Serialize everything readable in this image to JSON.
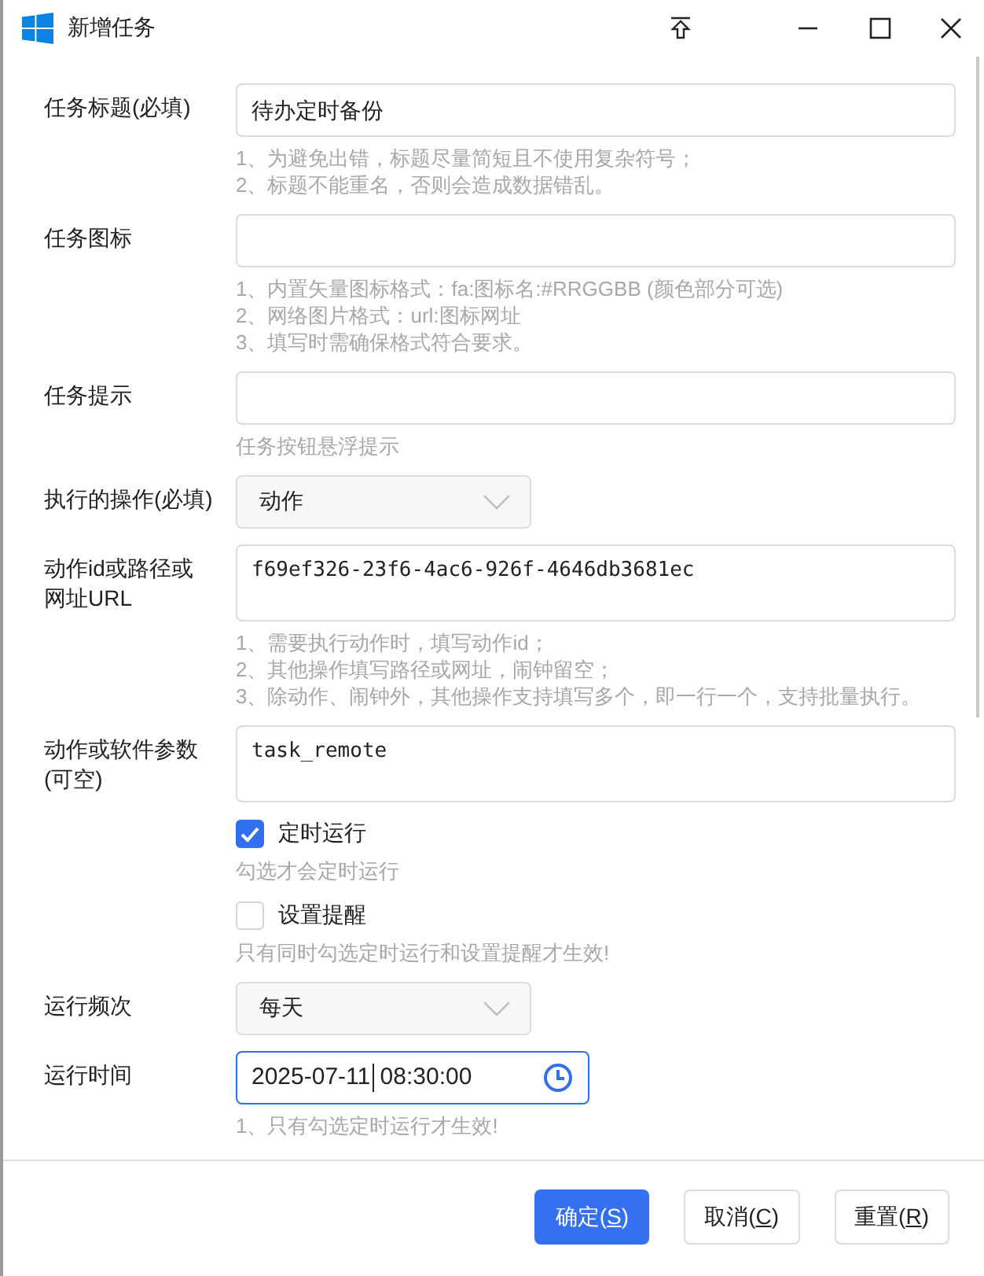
{
  "window": {
    "title": "新增任务"
  },
  "fields": [
    {
      "kind": "text",
      "label": "任务标题(必填)",
      "value": "待办定时备份",
      "hints": [
        "1、为避免出错，标题尽量简短且不使用复杂符号；",
        "2、标题不能重名，否则会造成数据错乱。"
      ]
    },
    {
      "kind": "text",
      "label": "任务图标",
      "hints": [
        "1、内置矢量图标格式：fa:图标名:#RRGGBB (颜色部分可选)",
        "2、网络图片格式：url:图标网址",
        "3、填写时需确保格式符合要求。"
      ]
    },
    {
      "kind": "text",
      "label": "任务提示",
      "hints": [
        "任务按钮悬浮提示"
      ]
    },
    {
      "kind": "select",
      "label": "执行的操作(必填)",
      "value": "动作"
    },
    {
      "kind": "textarea",
      "label": "动作id或路径或网址URL",
      "value": "f69ef326-23f6-4ac6-926f-4646db3681ec",
      "hints": [
        "1、需要执行动作时，填写动作id；",
        "2、其他操作填写路径或网址，闹钟留空；",
        "3、除动作、闹钟外，其他操作支持填写多个，即一行一个，支持批量执行。"
      ]
    },
    {
      "kind": "textarea",
      "label": "动作或软件参数(可空)",
      "value": "task_remote"
    },
    {
      "kind": "checkbox",
      "label": "定时运行",
      "checked": true,
      "hints": [
        "勾选才会定时运行"
      ]
    },
    {
      "kind": "checkbox",
      "label": "设置提醒",
      "checked": false,
      "hints": [
        "只有同时勾选定时运行和设置提醒才生效!"
      ]
    },
    {
      "kind": "select",
      "label": "运行频次",
      "value": "每天"
    },
    {
      "kind": "datetime",
      "label": "运行时间",
      "date": "2025-07-11",
      "time": "08:30:00",
      "focused": true,
      "hints": [
        "1、只有勾选定时运行才生效!"
      ]
    }
  ],
  "buttons": [
    {
      "before": "确定(",
      "key": "S",
      "after": ")",
      "primary": true
    },
    {
      "before": "取消(",
      "key": "C",
      "after": ")",
      "primary": false
    },
    {
      "before": "重置(",
      "key": "R",
      "after": ")",
      "primary": false
    }
  ]
}
